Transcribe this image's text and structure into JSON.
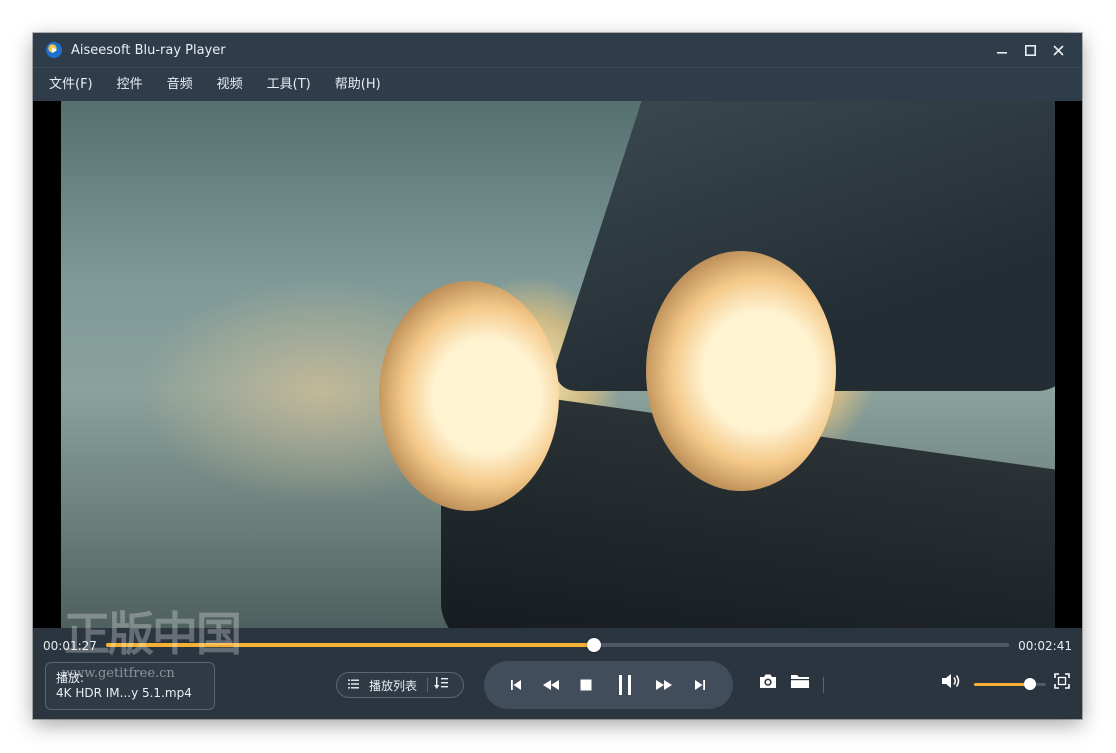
{
  "window": {
    "title": "Aiseesoft Blu-ray Player"
  },
  "menu": [
    "文件(F)",
    "控件",
    "音频",
    "视频",
    "工具(T)",
    "帮助(H)"
  ],
  "playback": {
    "current_time": "00:01:27",
    "total_time": "00:02:41",
    "progress": 0.54,
    "now_playing_label": "播放:",
    "now_playing_file": "4K HDR IM...y 5.1.mp4",
    "volume": 0.78
  },
  "playlist": {
    "label": "播放列表"
  },
  "watermark": {
    "text": "正版中国",
    "url": "www.getitfree.cn"
  },
  "colors": {
    "accent": "#f5b133",
    "background": "#2b3540"
  },
  "icons": {
    "transport": [
      "skip-previous-icon",
      "rewind-icon",
      "stop-icon",
      "pause-icon",
      "fast-forward-icon",
      "skip-next-icon"
    ],
    "tools": [
      "camera-icon",
      "folder-icon",
      "volume-icon",
      "fullscreen-icon"
    ]
  }
}
